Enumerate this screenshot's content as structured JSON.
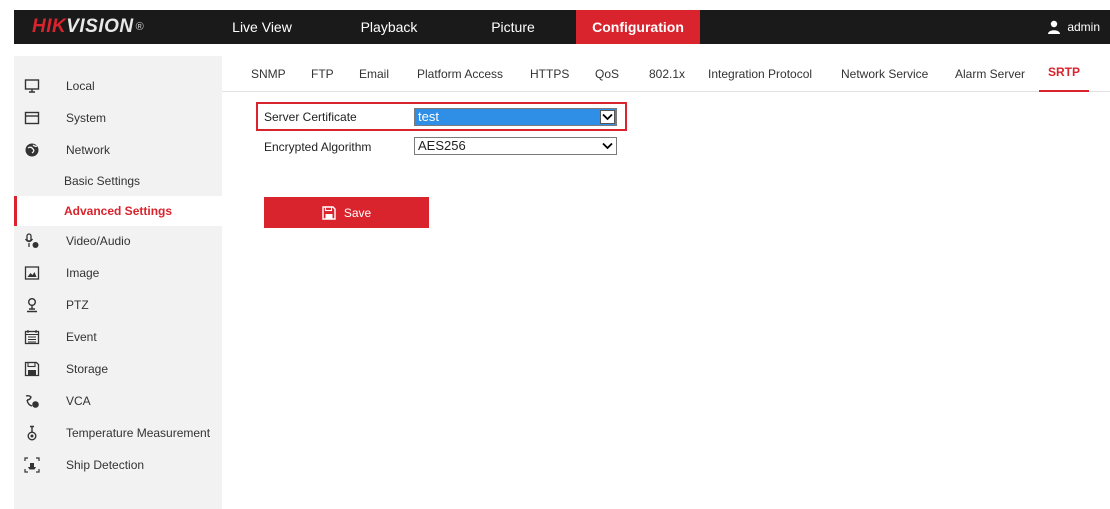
{
  "brand": {
    "name_red": "HIK",
    "name_rest": "VISION",
    "reg": "®"
  },
  "topnav": [
    {
      "label": "Live View",
      "active": false
    },
    {
      "label": "Playback",
      "active": false
    },
    {
      "label": "Picture",
      "active": false
    },
    {
      "label": "Configuration",
      "active": true
    }
  ],
  "user": {
    "name": "admin",
    "icon": "user-icon"
  },
  "sidebar": {
    "items": [
      {
        "label": "Local",
        "icon": "monitor-icon"
      },
      {
        "label": "System",
        "icon": "system-icon"
      },
      {
        "label": "Network",
        "icon": "globe-icon"
      },
      {
        "label": "Video/Audio",
        "icon": "microphone-camera-icon"
      },
      {
        "label": "Image",
        "icon": "image-icon"
      },
      {
        "label": "PTZ",
        "icon": "ptz-icon"
      },
      {
        "label": "Event",
        "icon": "calendar-icon"
      },
      {
        "label": "Storage",
        "icon": "floppy-icon"
      },
      {
        "label": "VCA",
        "icon": "vca-icon"
      },
      {
        "label": "Temperature Measurement",
        "icon": "thermometer-icon"
      },
      {
        "label": "Ship Detection",
        "icon": "ship-detection-icon"
      }
    ],
    "network_sub": [
      {
        "label": "Basic Settings",
        "active": false
      },
      {
        "label": "Advanced Settings",
        "active": true
      }
    ]
  },
  "tabs": [
    {
      "label": "SNMP",
      "active": false
    },
    {
      "label": "FTP",
      "active": false
    },
    {
      "label": "Email",
      "active": false
    },
    {
      "label": "Platform Access",
      "active": false
    },
    {
      "label": "HTTPS",
      "active": false
    },
    {
      "label": "QoS",
      "active": false
    },
    {
      "label": "802.1x",
      "active": false
    },
    {
      "label": "Integration Protocol",
      "active": false
    },
    {
      "label": "Network Service",
      "active": false
    },
    {
      "label": "Alarm Server",
      "active": false
    },
    {
      "label": "SRTP",
      "active": true
    }
  ],
  "form": {
    "server_certificate": {
      "label": "Server Certificate",
      "value": "test"
    },
    "encrypted_algorithm": {
      "label": "Encrypted Algorithm",
      "value": "AES256"
    }
  },
  "save_button": {
    "label": "Save"
  },
  "colors": {
    "accent": "#d9232d",
    "topbar": "#1a1a1a",
    "sidebar": "#f2f2f2",
    "select_highlight": "#2f8ee5"
  }
}
